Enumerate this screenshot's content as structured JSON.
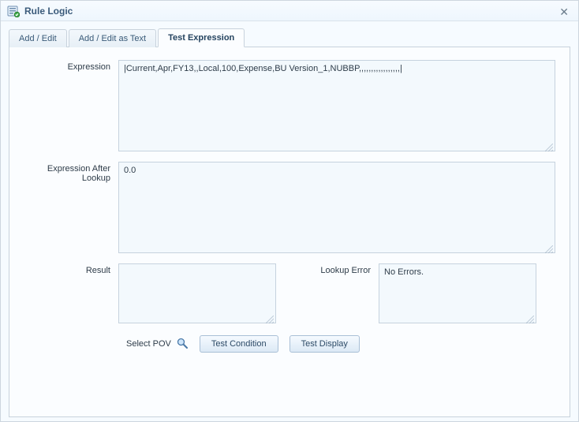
{
  "window": {
    "title": "Rule Logic"
  },
  "tabs": {
    "addEdit": "Add / Edit",
    "addEditText": "Add / Edit as Text",
    "testExpression": "Test Expression"
  },
  "labels": {
    "expression": "Expression",
    "expressionAfterLookup": "Expression After Lookup",
    "result": "Result",
    "lookupError": "Lookup Error",
    "selectPOV": "Select POV"
  },
  "fields": {
    "expression": "|Current,Apr,FY13,,Local,100,Expense,BU Version_1,NUBBP,,,,,,,,,,,,,,,,,|",
    "expressionAfterLookup": "0.0",
    "result": "",
    "lookupError": "No Errors."
  },
  "buttons": {
    "testCondition": "Test Condition",
    "testDisplay": "Test Display"
  }
}
